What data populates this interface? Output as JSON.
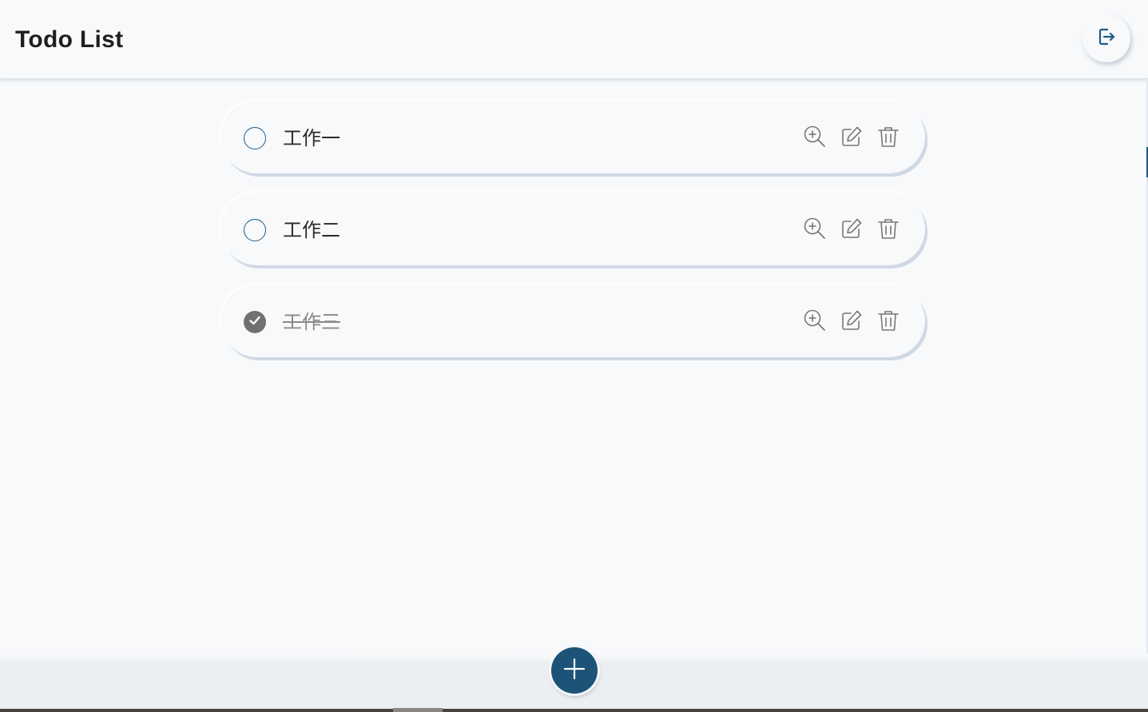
{
  "header": {
    "title": "Todo List",
    "logout_icon": "logout-icon"
  },
  "todos": [
    {
      "text": "工作一",
      "done": false
    },
    {
      "text": "工作二",
      "done": false
    },
    {
      "text": "工作三",
      "done": true
    }
  ],
  "icons": {
    "view": "zoom-in-icon",
    "edit": "edit-icon",
    "delete": "trash-icon",
    "add": "plus-icon"
  },
  "colors": {
    "accent": "#1d5377",
    "background": "#f7f9fb",
    "done_gray": "#707070"
  }
}
